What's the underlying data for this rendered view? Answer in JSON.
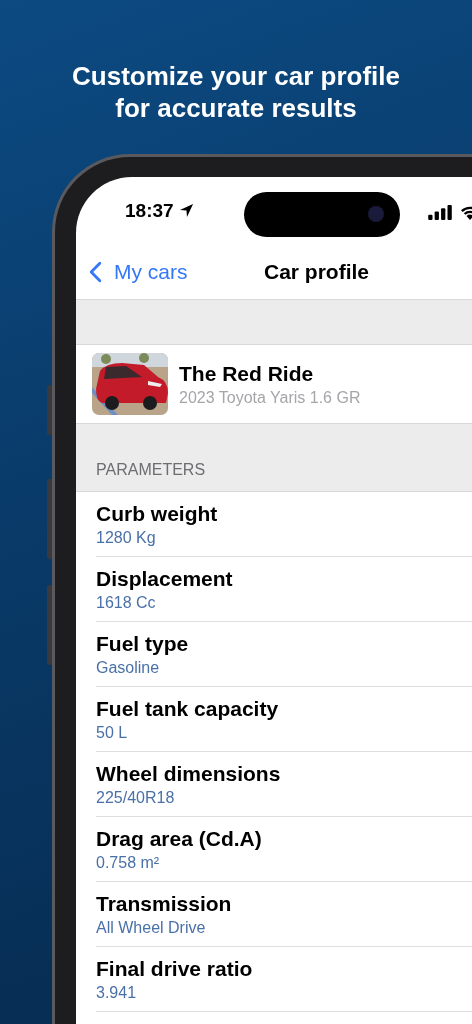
{
  "headline": "Customize your car profile for accurate results",
  "status_bar": {
    "time": "18:37"
  },
  "nav": {
    "back": "My cars",
    "title": "Car profile"
  },
  "car": {
    "name": "The Red Ride",
    "model": "2023 Toyota Yaris 1.6 GR"
  },
  "section": {
    "header": "PARAMETERS"
  },
  "parameters": [
    {
      "label": "Curb weight",
      "value": "1280 Kg"
    },
    {
      "label": "Displacement",
      "value": "1618 Cc"
    },
    {
      "label": "Fuel type",
      "value": "Gasoline"
    },
    {
      "label": "Fuel tank capacity",
      "value": "50 L"
    },
    {
      "label": "Wheel dimensions",
      "value": "225/40R18"
    },
    {
      "label": "Drag area (Cd.A)",
      "value": "0.758 m²"
    },
    {
      "label": "Transmission",
      "value": "All Wheel Drive"
    },
    {
      "label": "Final drive ratio",
      "value": "3.941"
    }
  ]
}
